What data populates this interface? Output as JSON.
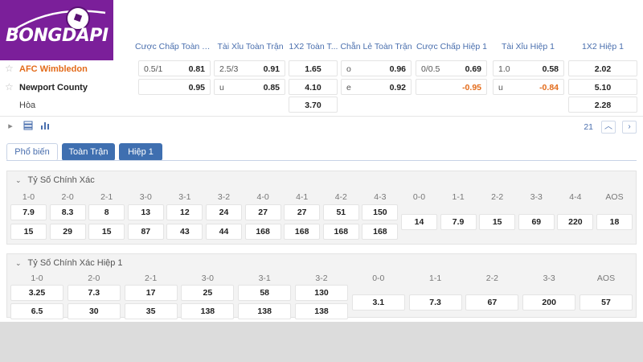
{
  "brand": {
    "logo_text": "BONGDAPI"
  },
  "markets": [
    "Cược Chấp Toàn T...",
    "Tài Xỉu Toàn Trận",
    "1X2 Toàn T...",
    "Chẵn Lẻ Toàn Trận",
    "Cược Chấp Hiệp 1",
    "Tài Xỉu Hiệp 1",
    "1X2 Hiệp 1"
  ],
  "teams": {
    "home": "AFC Wimbledon",
    "away": "Newport County",
    "draw": "Hòa"
  },
  "odds": {
    "home": {
      "hcp_ft": {
        "line": "0.5/1",
        "odd": "0.81"
      },
      "ou_ft": {
        "line": "2.5/3",
        "odd": "0.91"
      },
      "x12_ft": "1.65",
      "oe_ft": {
        "line": "o",
        "odd": "0.96"
      },
      "hcp_h1": {
        "line": "0/0.5",
        "odd": "0.69"
      },
      "ou_h1": {
        "line": "1.0",
        "odd": "0.58"
      },
      "x12_h1": "2.02"
    },
    "away": {
      "hcp_ft": {
        "line": "",
        "odd": "0.95"
      },
      "ou_ft": {
        "line": "u",
        "odd": "0.85"
      },
      "x12_ft": "4.10",
      "oe_ft": {
        "line": "e",
        "odd": "0.92"
      },
      "hcp_h1": {
        "line": "",
        "odd": "-0.95"
      },
      "ou_h1": {
        "line": "u",
        "odd": "-0.84"
      },
      "x12_h1": "5.10"
    },
    "draw": {
      "x12_ft": "3.70",
      "x12_h1": "2.28"
    }
  },
  "toolbar": {
    "count": "21",
    "up_icon": "chevron-up-icon",
    "next_icon": "chevron-right-icon"
  },
  "tabs": [
    "Phổ biến",
    "Toàn Trận",
    "Hiệp 1"
  ],
  "correct_score": {
    "title": "Tỷ Số Chính Xác",
    "labels": [
      "1-0",
      "2-0",
      "2-1",
      "3-0",
      "3-1",
      "3-2",
      "4-0",
      "4-1",
      "4-2",
      "4-3",
      "0-0",
      "1-1",
      "2-2",
      "3-3",
      "4-4",
      "AOS"
    ],
    "home_row": [
      "7.9",
      "8.3",
      "8",
      "13",
      "12",
      "24",
      "27",
      "27",
      "51",
      "150"
    ],
    "away_row": [
      "15",
      "29",
      "15",
      "87",
      "43",
      "44",
      "168",
      "168",
      "168",
      "168"
    ],
    "draws": [
      "14",
      "7.9",
      "15",
      "69",
      "220",
      "18"
    ]
  },
  "correct_score_h1": {
    "title": "Tỷ Số Chính Xác Hiệp 1",
    "labels": [
      "1-0",
      "2-0",
      "2-1",
      "3-0",
      "3-1",
      "3-2",
      "0-0",
      "1-1",
      "2-2",
      "3-3",
      "AOS"
    ],
    "home_row": [
      "3.25",
      "7.3",
      "17",
      "25",
      "58",
      "130"
    ],
    "away_row": [
      "6.5",
      "30",
      "35",
      "138",
      "138",
      "138"
    ],
    "draws": [
      "3.1",
      "7.3",
      "67",
      "200",
      "57"
    ]
  }
}
